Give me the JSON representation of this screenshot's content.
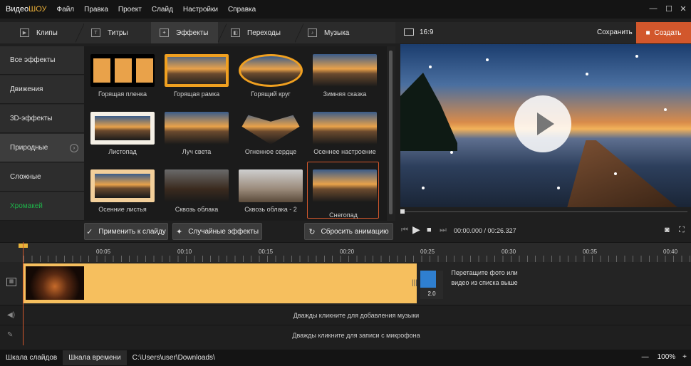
{
  "app": {
    "logo_main": "Видео",
    "logo_accent": "ШОУ"
  },
  "menu": [
    "Файл",
    "Правка",
    "Проект",
    "Слайд",
    "Настройки",
    "Справка"
  ],
  "window": {
    "minimize": "—",
    "maximize": "☐",
    "close": "✕"
  },
  "tabs": [
    {
      "label": "Клипы",
      "icon": "film-icon"
    },
    {
      "label": "Титры",
      "icon": "text-icon"
    },
    {
      "label": "Эффекты",
      "icon": "magic-wand-icon",
      "active": true
    },
    {
      "label": "Переходы",
      "icon": "transitions-icon"
    },
    {
      "label": "Музыка",
      "icon": "music-icon"
    }
  ],
  "categories": [
    {
      "label": "Все эффекты"
    },
    {
      "label": "Движения"
    },
    {
      "label": "3D-эффекты"
    },
    {
      "label": "Природные",
      "selected": true
    },
    {
      "label": "Сложные"
    },
    {
      "label": "Хромакей",
      "color": "#1fb24a"
    }
  ],
  "effects": [
    {
      "label": "Горящая пленка"
    },
    {
      "label": "Горящая рамка"
    },
    {
      "label": "Горящий круг"
    },
    {
      "label": "Зимняя сказка"
    },
    {
      "label": "Листопад"
    },
    {
      "label": "Луч света"
    },
    {
      "label": "Огненное сердце"
    },
    {
      "label": "Осеннее настроение"
    },
    {
      "label": "Осенние листья"
    },
    {
      "label": "Сквозь облака"
    },
    {
      "label": "Сквозь облака - 2"
    },
    {
      "label": "Снегопад",
      "selected": true
    }
  ],
  "actions": {
    "apply": "Применить к слайду",
    "random": "Случайные эффекты",
    "reset": "Сбросить анимацию"
  },
  "preview": {
    "ratio": "16:9",
    "save": "Сохранить",
    "create": "Создать",
    "timecode": "00:00.000 / 00:26.327"
  },
  "ruler_ticks": [
    "00:05",
    "00:10",
    "00:15",
    "00:20",
    "00:25",
    "00:30",
    "00:35",
    "00:40"
  ],
  "timeline": {
    "transition_duration": "2.0",
    "drop_hint": "Перетащите фото или видео из списка выше",
    "music_hint": "Дважды кликните для добавления музыки",
    "mic_hint": "Дважды кликните для записи с микрофона"
  },
  "statusbar": {
    "slides_tab": "Шкала слайдов",
    "time_tab": "Шкала времени",
    "path": "C:\\Users\\user\\Downloads\\",
    "zoom_minus": "—",
    "zoom_value": "100%",
    "zoom_plus": "+"
  },
  "colors": {
    "accent": "#d2572c",
    "clip": "#f6bf5e",
    "chroma": "#1fb24a",
    "transition": "#2f7fd0"
  }
}
